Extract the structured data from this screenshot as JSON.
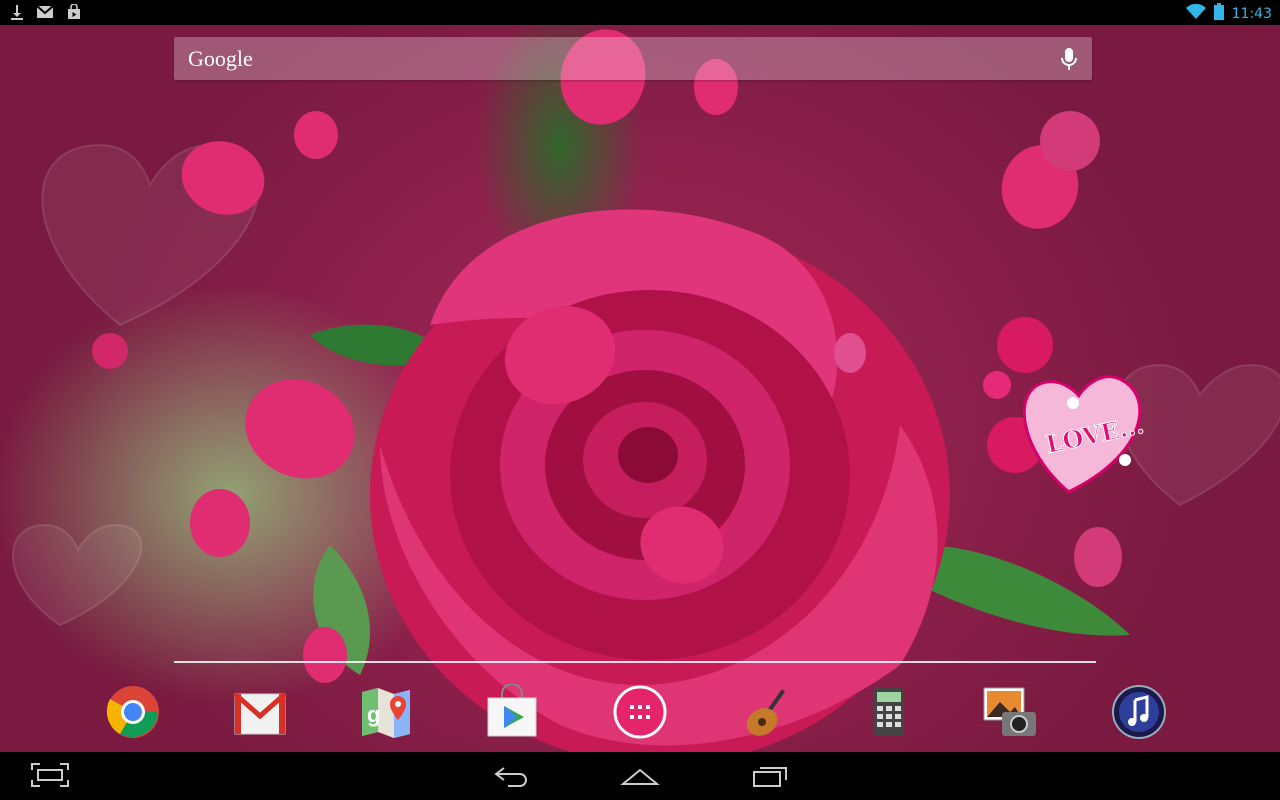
{
  "status_bar": {
    "time": "11:43",
    "left_icons": [
      "download-icon",
      "gmail-notification-icon",
      "play-store-notification-icon"
    ],
    "right_icons": [
      "wifi-icon",
      "battery-icon"
    ]
  },
  "search": {
    "logo_text": "Google",
    "mic_icon": "mic-icon"
  },
  "widget": {
    "love_text": "LOVE..."
  },
  "dock": {
    "apps": [
      {
        "name": "Chrome",
        "icon": "chrome-icon"
      },
      {
        "name": "Gmail",
        "icon": "gmail-icon"
      },
      {
        "name": "Maps",
        "icon": "maps-icon"
      },
      {
        "name": "Play Store",
        "icon": "play-store-icon"
      },
      {
        "name": "All Apps",
        "icon": "apps-grid-icon"
      },
      {
        "name": "GarageBand",
        "icon": "guitar-icon"
      },
      {
        "name": "Calculator",
        "icon": "calculator-icon"
      },
      {
        "name": "Photos",
        "icon": "photo-camera-icon"
      },
      {
        "name": "Music",
        "icon": "music-note-icon"
      }
    ]
  },
  "nav": {
    "buttons": [
      "screenshot-icon",
      "back-icon",
      "home-icon",
      "recents-icon"
    ]
  },
  "colors": {
    "accent_time": "#33b5e5",
    "wallpaper_bg": "#8a1e48",
    "rose_pink": "#e0286a"
  }
}
